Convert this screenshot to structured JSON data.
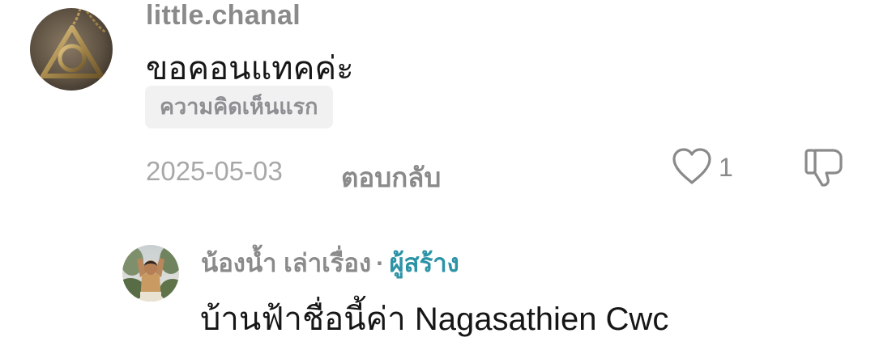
{
  "comment": {
    "username": "little.chanal",
    "text": "ขอคอนแทคค่ะ",
    "badge": "ความคิดเห็นแรก",
    "date": "2025-05-03",
    "reply_label": "ตอบกลับ",
    "like_count": "1",
    "avatar_icon": "deathly-hallows-pendant"
  },
  "reply": {
    "username": "น้องน้ำ เล่าเรื่อง",
    "separator": "·",
    "creator_label": "ผู้สร้าง",
    "text": "บ้านฟ้าชื่อนี้ค่า Nagasathien Cwc",
    "avatar_icon": "person-photo"
  },
  "colors": {
    "username": "#8a8a8a",
    "text": "#161616",
    "creator": "#2c93a6",
    "badge_bg": "#f1f1f2"
  }
}
